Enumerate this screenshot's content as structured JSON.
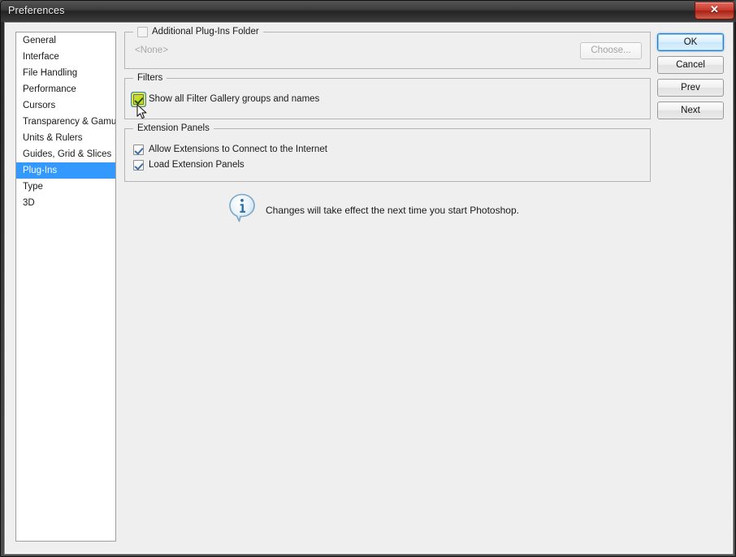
{
  "window": {
    "title": "Preferences",
    "close_label": "✕",
    "close_icon": "close-icon"
  },
  "sidebar": {
    "items": [
      {
        "label": "General",
        "selected": false
      },
      {
        "label": "Interface",
        "selected": false
      },
      {
        "label": "File Handling",
        "selected": false
      },
      {
        "label": "Performance",
        "selected": false
      },
      {
        "label": "Cursors",
        "selected": false
      },
      {
        "label": "Transparency & Gamut",
        "selected": false
      },
      {
        "label": "Units & Rulers",
        "selected": false
      },
      {
        "label": "Guides, Grid & Slices",
        "selected": false
      },
      {
        "label": "Plug-Ins",
        "selected": true
      },
      {
        "label": "Type",
        "selected": false
      },
      {
        "label": "3D",
        "selected": false
      }
    ]
  },
  "buttons": {
    "ok": "OK",
    "cancel": "Cancel",
    "prev": "Prev",
    "next": "Next"
  },
  "plugin_folder": {
    "legend": "Additional Plug-Ins Folder",
    "checked": false,
    "path_value": "<None>",
    "choose_label": "Choose...",
    "choose_enabled": false
  },
  "filters": {
    "legend": "Filters",
    "option_label": "Show all Filter Gallery groups and names",
    "checked": true,
    "highlight_color": "#c8dd2a"
  },
  "extension_panels": {
    "legend": "Extension Panels",
    "options": [
      {
        "label": "Allow Extensions to Connect to the Internet",
        "checked": true
      },
      {
        "label": "Load Extension Panels",
        "checked": true
      }
    ]
  },
  "note": {
    "icon": "info-icon",
    "text": "Changes will take effect the next time you start Photoshop."
  },
  "colors": {
    "selection_blue": "#3399ff",
    "titlebar_dark": "#2a2a2a",
    "close_red": "#c63a2c",
    "dialog_bg": "#efefef"
  }
}
